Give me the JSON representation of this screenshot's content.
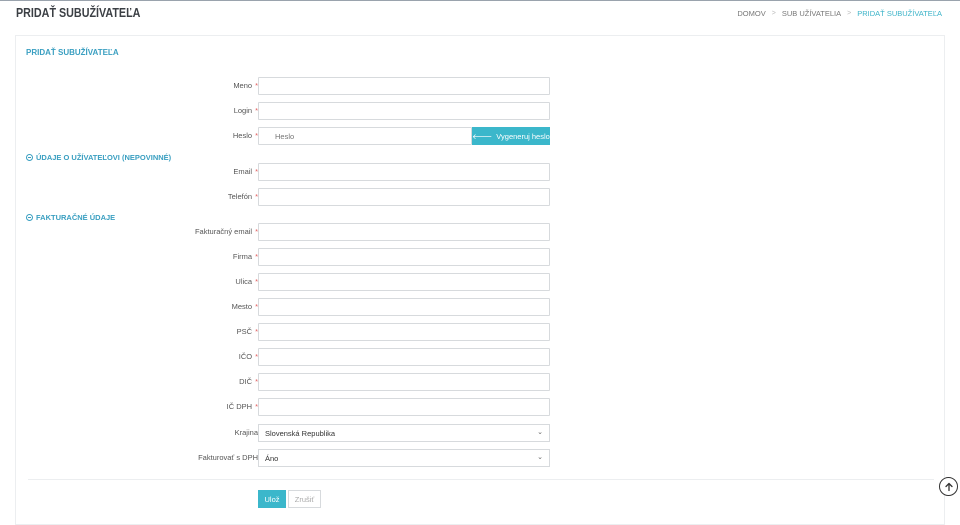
{
  "header": {
    "title": "PRIDAŤ SUBUŽÍVATEĽA",
    "breadcrumb": [
      "DOMOV",
      "SUB UŽÍVATELIA",
      "PRIDAŤ SUBUŽÍVATEĽA"
    ]
  },
  "form": {
    "title": "PRIDAŤ SUBUŽÍVATEĽA",
    "required_mark": "*",
    "fields": {
      "meno": "Meno",
      "login": "Login",
      "heslo": "Heslo",
      "heslo_placeholder": "Heslo",
      "generate_button": "Vygeneruj heslo",
      "email": "Email",
      "telefon": "Telefón",
      "fakturacny_email": "Fakturačný email",
      "firma": "Firma",
      "ulica": "Ulica",
      "mesto": "Mesto",
      "psc": "PSČ",
      "ico": "IČO",
      "dic": "DIČ",
      "ic_dph": "IČ DPH",
      "krajina": "Krajina",
      "krajina_value": "Slovenská Republika",
      "fakturovat_dph": "Fakturovať s DPH",
      "fakturovat_dph_value": "Áno"
    },
    "sections": {
      "user_info": "ÚDAJE O UŽÍVATEĽOVI (NEPOVINNÉ)",
      "billing": "FAKTURAČNÉ ÚDAJE"
    },
    "buttons": {
      "save": "Ulož",
      "cancel": "Zrušiť"
    }
  },
  "colors": {
    "accent": "#3bb7cb",
    "title_blue": "#3a9fc1",
    "required": "#e05a5a"
  }
}
